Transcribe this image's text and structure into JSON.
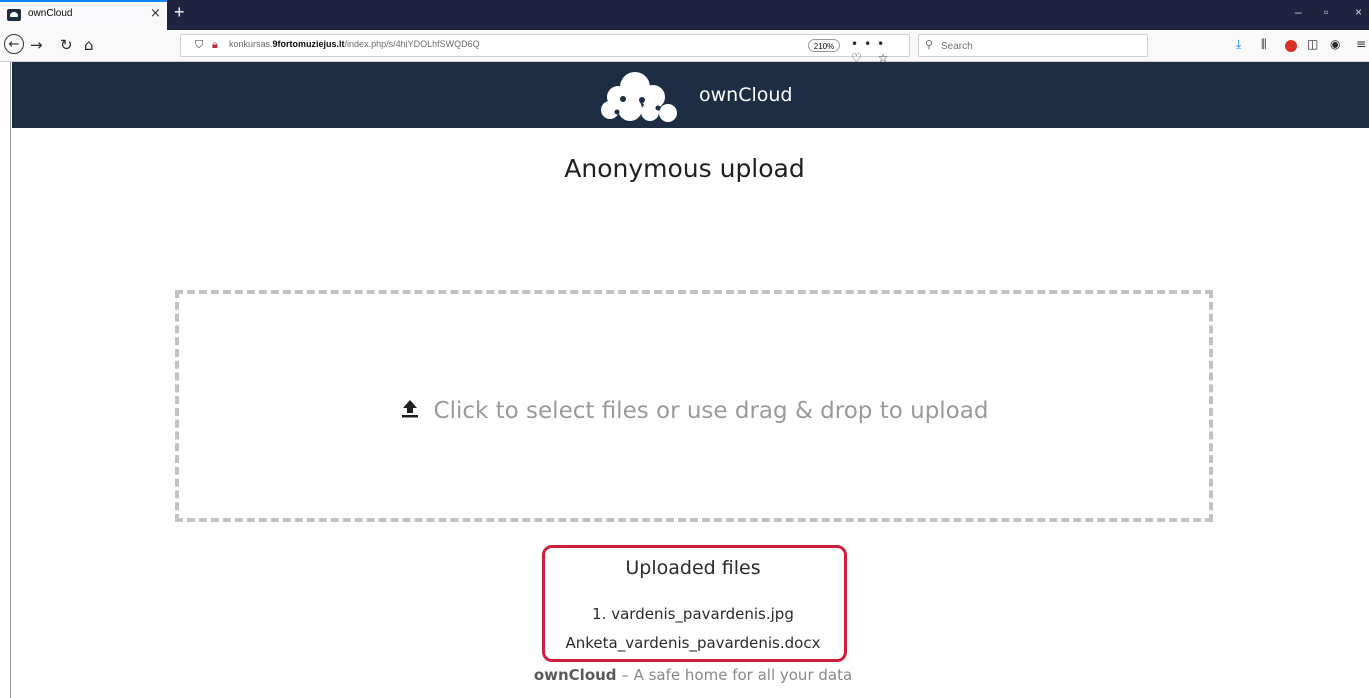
{
  "browser": {
    "tab_title": "ownCloud",
    "tab_close": "×",
    "new_tab": "+",
    "window_controls": {
      "minimize": "–",
      "restore": "▫",
      "close": "×"
    },
    "url_prefix": "konkursas.",
    "url_domain": "9fortomuziejus.lt",
    "url_path": "/index.php/s/4hiYDOLhfSWQD6Q",
    "zoom": "210%",
    "search_placeholder": "Search",
    "icons": {
      "back": "back-arrow-icon",
      "forward": "forward-arrow-icon",
      "reload": "reload-icon",
      "home": "home-icon",
      "shield": "tracking-shield-icon",
      "lock": "insecure-lock-icon",
      "page_actions": "more-icon",
      "pocket": "pocket-icon",
      "bookmark": "star-icon",
      "downloads": "download-icon",
      "library": "library-icon",
      "adblock": "adblock-icon",
      "sidebar": "sidebar-icon",
      "extension": "extension-icon",
      "menu": "hamburger-menu-icon"
    }
  },
  "header": {
    "brand": "ownCloud",
    "bg_color": "#1d2d44"
  },
  "main": {
    "title": "Anonymous upload",
    "dropzone_text": "Click to select files or use drag & drop to upload",
    "uploaded_title": "Uploaded files",
    "files": [
      "1. vardenis_pavardenis.jpg",
      "Anketa_vardenis_pavardenis.docx"
    ],
    "highlight_color": "#d01f3c"
  },
  "footer": {
    "brand": "ownCloud",
    "tagline": " – A safe home for all your data"
  }
}
